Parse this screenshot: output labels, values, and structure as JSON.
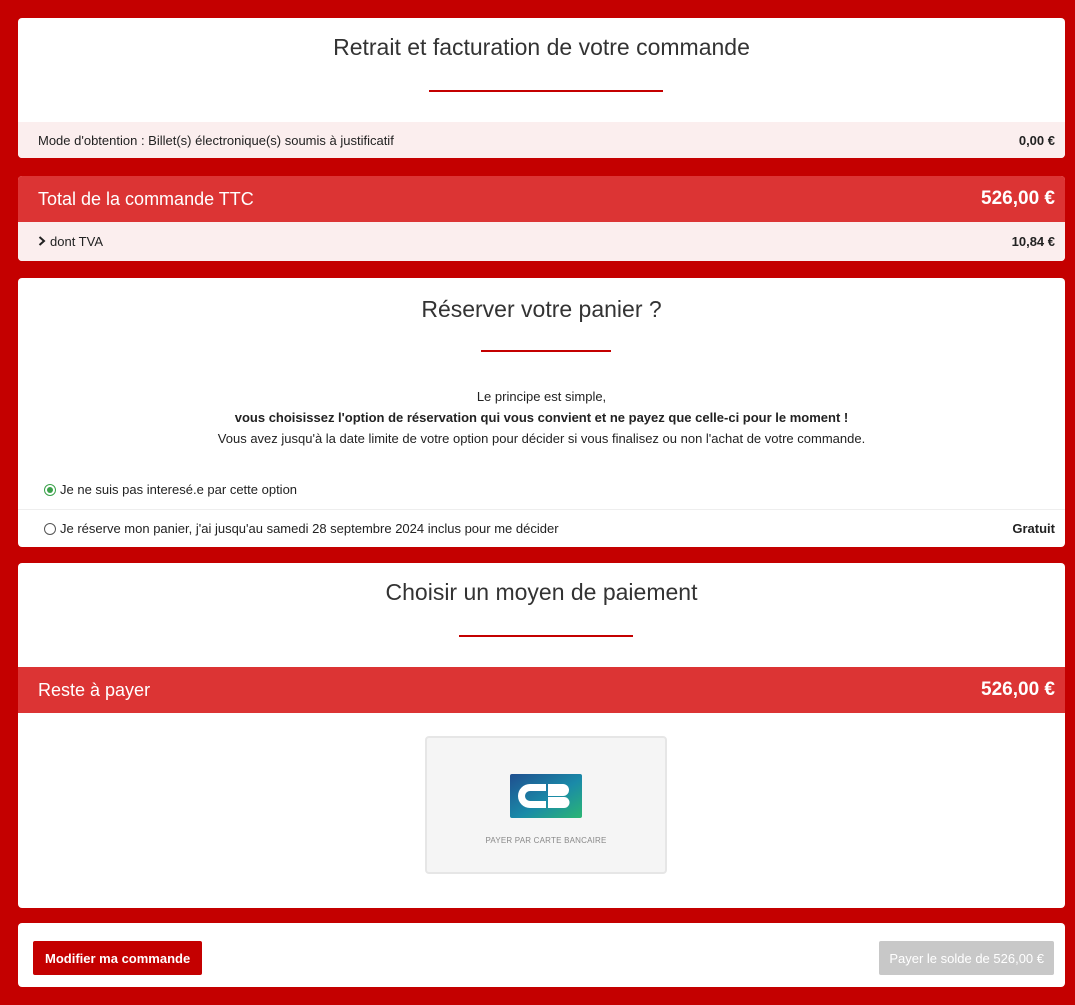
{
  "retrait": {
    "title": "Retrait et facturation de votre commande",
    "mode_label": "Mode d'obtention : Billet(s) électronique(s) soumis à justificatif",
    "mode_price": "0,00 €"
  },
  "total": {
    "label": "Total de la commande TTC",
    "amount": "526,00 €",
    "tva_label": "dont TVA",
    "tva_amount": "10,84 €"
  },
  "reserve": {
    "title": "Réserver votre panier ?",
    "line1": "Le principe est simple,",
    "line2": "vous choisissez l'option de réservation qui vous convient et ne payez que celle-ci pour le moment !",
    "line3": "Vous avez jusqu'à la date limite de votre option pour décider si vous finalisez ou non l'achat de votre commande.",
    "option_no": "Je ne suis pas interesé.e par cette option",
    "option_yes": "Je réserve mon panier, j'ai jusqu'au samedi 28 septembre 2024 inclus pour me décider",
    "option_yes_price": "Gratuit",
    "selected": "option_no"
  },
  "payment": {
    "title": "Choisir un moyen de paiement",
    "reste_label": "Reste à payer",
    "reste_amount": "526,00 €",
    "cb_logo": "CB",
    "cb_label": "PAYER PAR CARTE BANCAIRE"
  },
  "footer": {
    "modify_button": "Modifier ma commande",
    "pay_button": "Payer le solde de 526,00 €"
  },
  "colors": {
    "brand_red": "#c40000",
    "bar_red": "#dc3434",
    "pink_row": "#fbeeee",
    "selected_radio": "#3aa14a"
  }
}
